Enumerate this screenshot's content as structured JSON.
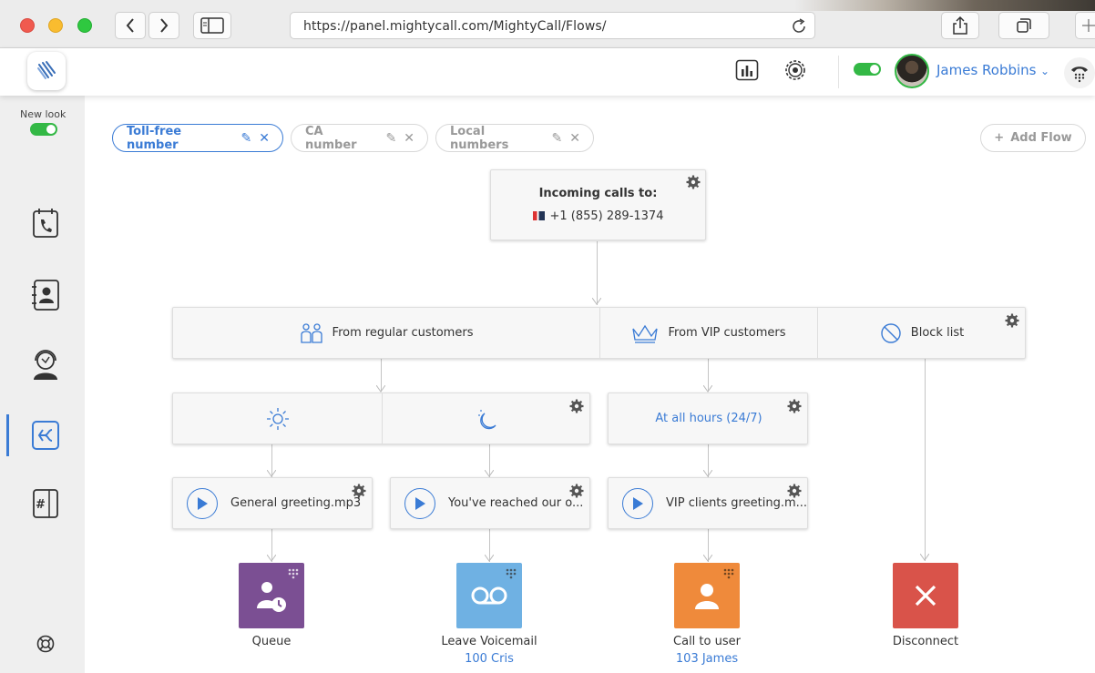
{
  "browser": {
    "url": "https://panel.mightycall.com/MightyCall/Flows/"
  },
  "header": {
    "user_name": "James Robbins",
    "icons": [
      "reports-icon",
      "settings-icon",
      "dialpad-icon"
    ],
    "status_toggle": true
  },
  "sidebar": {
    "new_look_label": "New look",
    "new_look_on": true,
    "items": [
      "calls-icon",
      "contacts-icon",
      "agents-icon",
      "flows-icon",
      "numbers-icon",
      "help-icon"
    ],
    "active": "flows-icon"
  },
  "tabs": [
    {
      "label": "Toll-free number",
      "active": true
    },
    {
      "label": "CA number",
      "active": false
    },
    {
      "label": "Local numbers",
      "active": false
    }
  ],
  "add_flow_label": "Add Flow",
  "flow": {
    "incoming_title": "Incoming calls to:",
    "incoming_number": "+1 (855) 289-1374",
    "filters": {
      "regular": "From regular customers",
      "vip": "From VIP customers",
      "block": "Block list"
    },
    "hours_vip": "At all hours (24/7)",
    "greetings": {
      "day": "General greeting.mp3",
      "night": "You've reached our o...",
      "vip": "VIP clients greeting.m..."
    },
    "actions": [
      {
        "label": "Queue",
        "sub": "",
        "color": "#7b4f93"
      },
      {
        "label": "Leave Voicemail",
        "sub": "100 Cris",
        "color": "#6fb1e3"
      },
      {
        "label": "Call to user",
        "sub": "103 James",
        "color": "#ef8a3b"
      },
      {
        "label": "Disconnect",
        "sub": "",
        "color": "#d9534a"
      }
    ]
  },
  "colors": {
    "accent": "#3a7bd5",
    "toggle_green": "#33b845"
  }
}
